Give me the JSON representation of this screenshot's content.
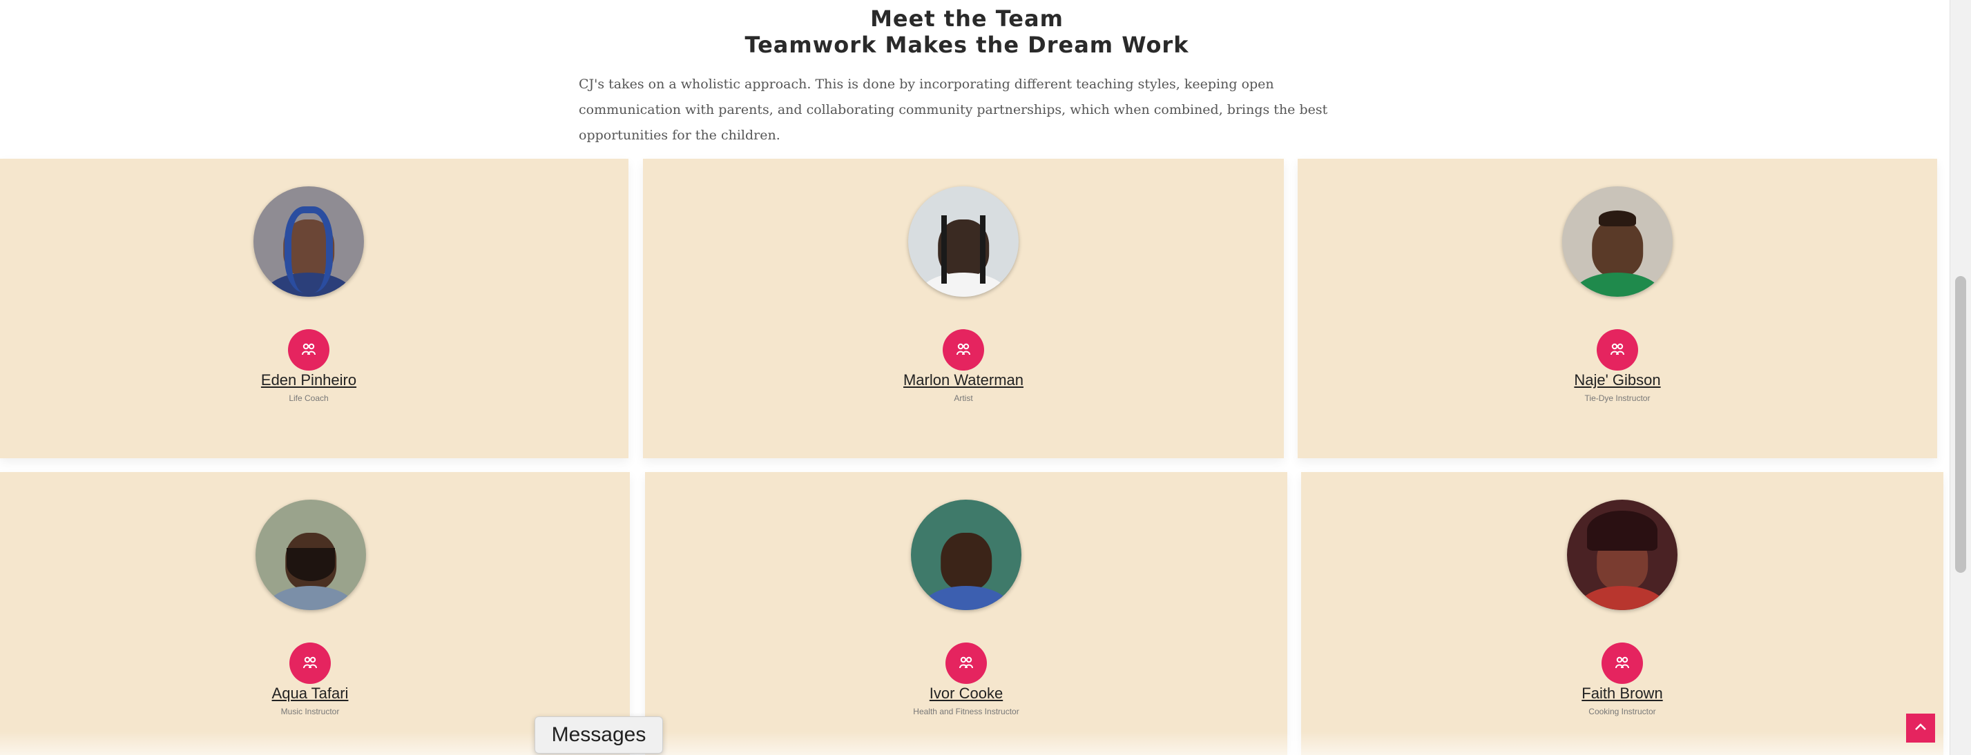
{
  "header": {
    "title_line1": "Meet the Team",
    "title_line2": "Teamwork Makes the Dream Work",
    "intro": "CJ's takes on a wholistic approach. This is done by incorporating different teaching styles, keeping open communication with parents, and collaborating community partnerships, which when combined, brings the best opportunities for the children."
  },
  "team": [
    {
      "name": "Eden Pinheiro",
      "role": "Life Coach"
    },
    {
      "name": "Marlon Waterman",
      "role": "Artist"
    },
    {
      "name": "Naje' Gibson",
      "role": "Tie-Dye Instructor"
    },
    {
      "name": "Aqua Tafari",
      "role": "Music Instructor"
    },
    {
      "name": "Ivor Cooke",
      "role": "Health and Fitness Instructor"
    },
    {
      "name": "Faith Brown",
      "role": "Cooking Instructor"
    }
  ],
  "widgets": {
    "messages_label": "Messages",
    "back_to_top_icon": "chevron-up-icon",
    "team_badge_icon": "people-icon"
  },
  "colors": {
    "card_bg": "#f5e6cd",
    "accent": "#e5245f"
  }
}
